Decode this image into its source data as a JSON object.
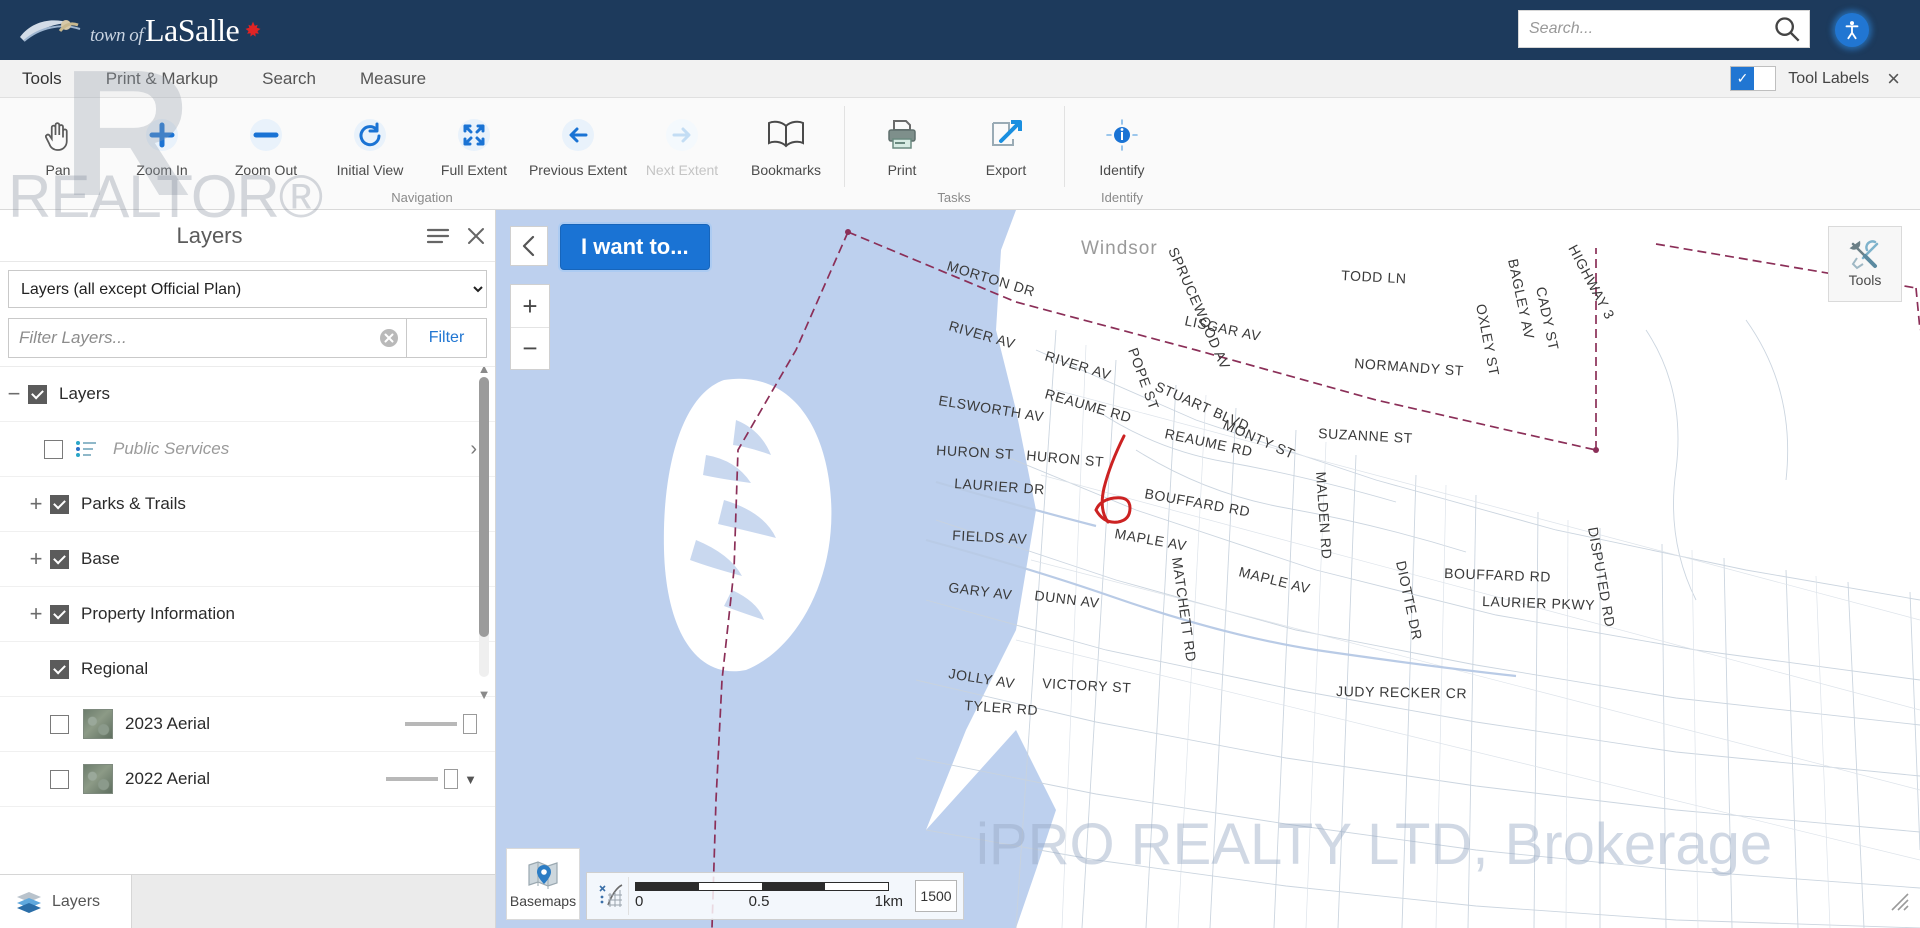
{
  "header": {
    "brand_prefix": "town of",
    "brand_name": "LaSalle",
    "brand_leaf_icon": "maple-leaf-icon",
    "search": {
      "placeholder": "Search...",
      "value": "",
      "icon": "search-icon"
    },
    "accessibility_icon": "accessibility-icon"
  },
  "tabbar": {
    "tabs": [
      {
        "label": "Tools",
        "active": true
      },
      {
        "label": "Print & Markup",
        "active": false
      },
      {
        "label": "Search",
        "active": false
      },
      {
        "label": "Measure",
        "active": false
      }
    ],
    "tool_labels_toggle": {
      "label": "Tool Labels",
      "on": true
    },
    "close_label": "×"
  },
  "ribbon": {
    "groups": [
      {
        "title": "Navigation",
        "items": [
          {
            "label": "Pan",
            "icon": "hand-icon",
            "disabled": false
          },
          {
            "label": "Zoom In",
            "icon": "zoom-in-icon",
            "disabled": false
          },
          {
            "label": "Zoom Out",
            "icon": "zoom-out-icon",
            "disabled": false
          },
          {
            "label": "Initial View",
            "icon": "refresh-icon",
            "disabled": false
          },
          {
            "label": "Full Extent",
            "icon": "expand-arrows-icon",
            "disabled": false
          },
          {
            "label": "Previous Extent",
            "icon": "arrow-left-icon",
            "disabled": false
          },
          {
            "label": "Next Extent",
            "icon": "arrow-right-icon",
            "disabled": true
          },
          {
            "label": "Bookmarks",
            "icon": "book-icon",
            "disabled": false
          }
        ]
      },
      {
        "title": "Tasks",
        "items": [
          {
            "label": "Print",
            "icon": "printer-icon",
            "disabled": false
          },
          {
            "label": "Export",
            "icon": "export-arrow-icon",
            "disabled": false
          }
        ]
      },
      {
        "title": "Identify",
        "items": [
          {
            "label": "Identify",
            "icon": "info-target-icon",
            "disabled": false
          }
        ]
      }
    ]
  },
  "layers_panel": {
    "title": "Layers",
    "menu_icon": "hamburger-icon",
    "close_icon": "close-icon",
    "selected_layer_set": "Layers (all except Official Plan)",
    "layer_set_options": [
      "Layers (all except Official Plan)"
    ],
    "filter": {
      "placeholder": "Filter Layers...",
      "value": "",
      "clear_icon": "clear-circle-icon"
    },
    "filter_button": "Filter",
    "tree": [
      {
        "label": "Layers",
        "checked": true,
        "toggle": "minus",
        "indent": 0,
        "kind": "group"
      },
      {
        "label": "Public Services",
        "checked": false,
        "toggle": "none",
        "indent": 1,
        "kind": "service",
        "muted": true,
        "chevron": true
      },
      {
        "label": "Parks & Trails",
        "checked": true,
        "toggle": "plus",
        "indent": 0,
        "kind": "group"
      },
      {
        "label": "Base",
        "checked": true,
        "toggle": "plus",
        "indent": 0,
        "kind": "group"
      },
      {
        "label": "Property Information",
        "checked": true,
        "toggle": "plus",
        "indent": 0,
        "kind": "group"
      },
      {
        "label": "Regional",
        "checked": true,
        "toggle": "none",
        "indent": 0,
        "kind": "group"
      },
      {
        "label": "2023 Aerial",
        "checked": false,
        "toggle": "none",
        "indent": 1,
        "kind": "raster",
        "slider": true
      },
      {
        "label": "2022 Aerial",
        "checked": false,
        "toggle": "none",
        "indent": 1,
        "kind": "raster",
        "slider": true
      }
    ],
    "footer_tab": {
      "label": "Layers",
      "icon": "layers-stack-icon"
    }
  },
  "map": {
    "collapse_icon": "chevron-left-icon",
    "i_want_to_button": "I want to...",
    "zoom_in": "+",
    "zoom_out": "−",
    "tools_button": {
      "label": "Tools",
      "icon": "tools-wrench-icon"
    },
    "basemaps_button": {
      "label": "Basemaps",
      "icon": "map-pin-icon"
    },
    "coordinates_icon": "coordinates-grid-icon",
    "scalebar": {
      "labels": [
        "0",
        "0.5",
        "1km"
      ]
    },
    "scale_value": "1500",
    "resize_icon": "resize-handle-icon",
    "city_label": "Windsor",
    "street_labels": [
      "MORTON DR",
      "RIVER AV",
      "RIVER AV",
      "POPE ST",
      "SPRUCEWOOD AV",
      "LISGAR AV",
      "TODD LN",
      "BAGLEY AV",
      "OXLEY ST",
      "CADY ST",
      "HIGHWAY 3",
      "NORMANDY ST",
      "ELSWORTH AV",
      "REAUME RD",
      "STUART BLVD",
      "MONTY ST",
      "SUZANNE ST",
      "HURON ST",
      "HURON ST",
      "REAUME RD",
      "LAURIER DR",
      "BOUFFARD RD",
      "MALDEN RD",
      "FIELDS AV",
      "MAPLE AV",
      "MAPLE AV",
      "DIOTTE DR",
      "BOUFFARD RD",
      "DISPUTED RD",
      "GARY AV",
      "DUNN AV",
      "MATCHETT RD",
      "LAURIER PKWY",
      "JUDY RECKER CR",
      "JOLLY AV",
      "VICTORY ST",
      "TYLER RD"
    ]
  },
  "watermarks": {
    "realtor": "REALTOR®",
    "r_logo": "R",
    "brokerage": "iPRO REALTY LTD, Brokerage"
  },
  "colors": {
    "header_bg": "#1d3a5c",
    "accent_blue": "#1a73d4",
    "water": "#bdd0ee",
    "boundary": "#8b2f58",
    "highlight_red": "#cc2222"
  }
}
